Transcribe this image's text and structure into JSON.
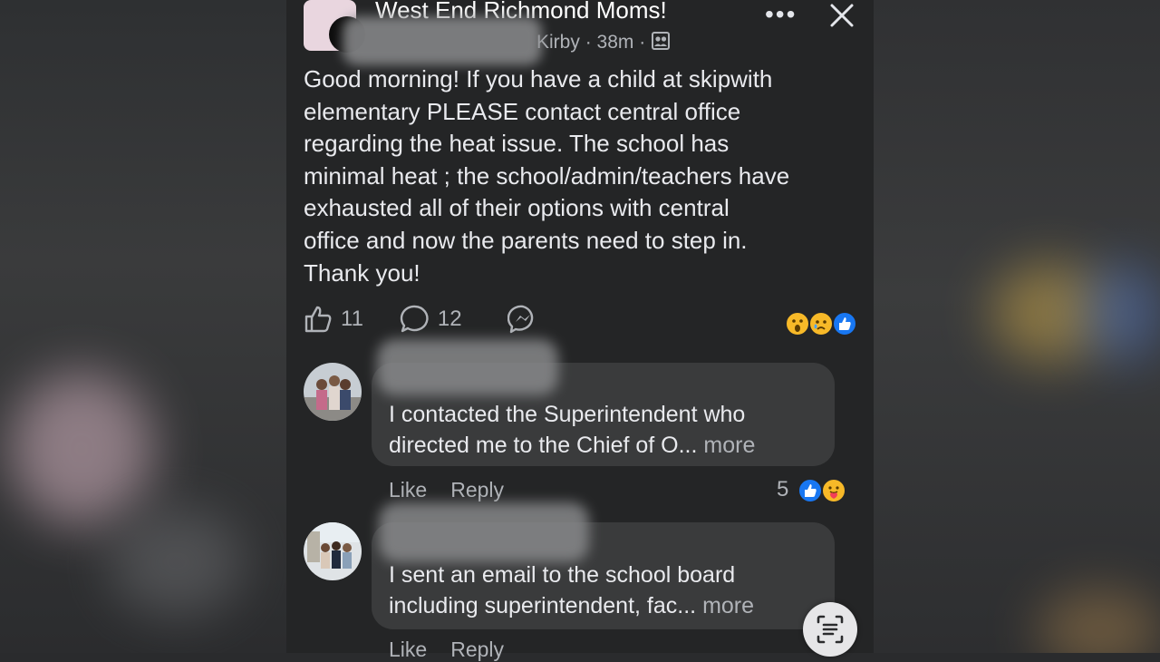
{
  "post": {
    "group_name": "West End Richmond Moms!",
    "author_fragment": "Kirby",
    "time": "38m",
    "text_lines": [
      "Good morning! If you have a child at skipwith",
      "elementary PLEASE contact central office",
      "regarding the heat issue. The school has",
      "minimal heat ; the school/admin/teachers have",
      "exhausted all of their options with central",
      "office and now the parents need to step in.",
      "Thank you!"
    ],
    "like_count": "11",
    "comment_count": "12"
  },
  "comments": [
    {
      "line1": "I contacted the Superintendent who",
      "line2": "directed me to the Chief of O...",
      "more": "more",
      "like": "Like",
      "reply": "Reply",
      "reaction_count": "5"
    },
    {
      "line1": "I sent an email to the school board",
      "line2": "including superintendent, fac...",
      "more": "more",
      "like": "Like",
      "reply": "Reply"
    }
  ],
  "colors": {
    "background": "#242526",
    "bubble": "#3a3b3c",
    "text": "#e4e6eb",
    "secondary": "#b0b3b8",
    "like_blue": "#1877f2",
    "wow_yellow": "#f7b928"
  },
  "icons": [
    "more-options-icon",
    "close-icon",
    "globe-members-icon",
    "like-icon",
    "comment-icon",
    "messenger-icon",
    "wow-reaction-icon",
    "sad-reaction-icon",
    "like-reaction-icon",
    "care-reaction-icon",
    "lens-icon"
  ]
}
